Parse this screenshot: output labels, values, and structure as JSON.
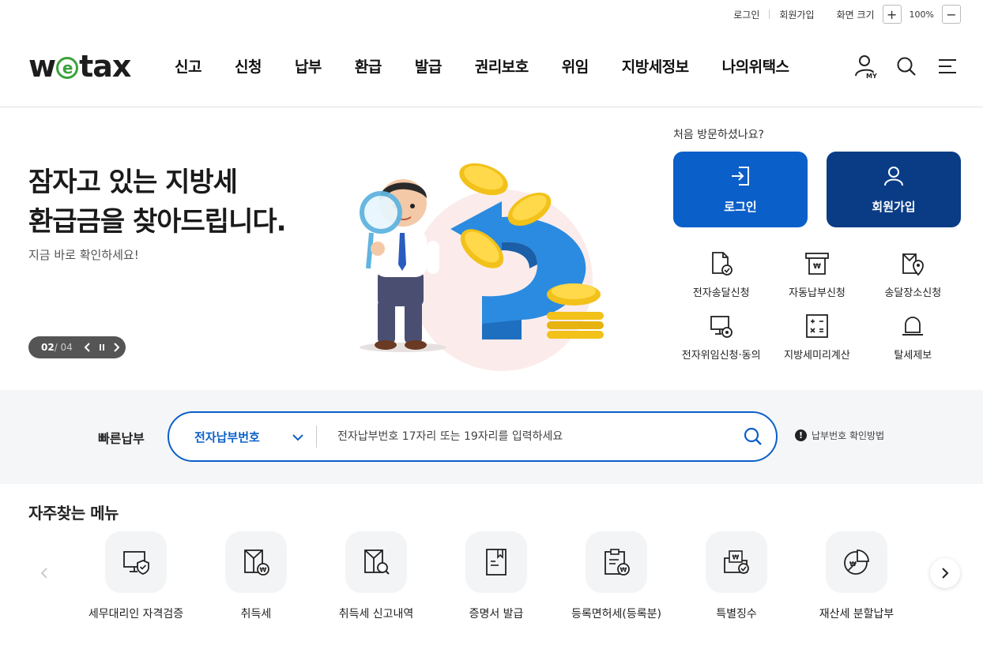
{
  "util": {
    "login": "로그인",
    "join": "회원가입",
    "zoom_label": "화면 크기",
    "zoom_in": "+",
    "zoom_value": "100%",
    "zoom_out": "−"
  },
  "header": {
    "logo": "wetax",
    "nav": [
      "신고",
      "신청",
      "납부",
      "환급",
      "발급",
      "권리보호",
      "위임",
      "지방세정보",
      "나의위택스"
    ],
    "icons": [
      "my-page-icon",
      "search-icon",
      "menu-icon"
    ],
    "my_badge": "MY"
  },
  "hero": {
    "title": "잠자고 있는 지방세\n환급금을 찾아드립니다.",
    "subtitle": "지금 바로 확인하세요!",
    "slide_current": "02",
    "slide_total": "/ 04"
  },
  "side": {
    "first_visit": "처음 방문하셨나요?",
    "login_button": "로그인",
    "join_button": "회원가입",
    "quick": [
      {
        "label": "전자송달신청",
        "icon": "e-delivery-icon"
      },
      {
        "label": "자동납부신청",
        "icon": "auto-pay-icon"
      },
      {
        "label": "송달장소신청",
        "icon": "delivery-location-icon"
      },
      {
        "label": "전자위임신청·동의",
        "icon": "e-delegation-icon"
      },
      {
        "label": "지방세미리계산",
        "icon": "calculator-icon"
      },
      {
        "label": "탈세제보",
        "icon": "alarm-bell-icon"
      }
    ]
  },
  "pay": {
    "label": "빠른납부",
    "select_value": "전자납부번호",
    "placeholder": "전자납부번호 17자리 또는 19자리를 입력하세요",
    "help": "납부번호 확인방법",
    "help_mark": "!"
  },
  "freq": {
    "title": "자주찾는 메뉴",
    "items": [
      {
        "label": "세무대리인 자격검증",
        "icon": "monitor-shield-icon"
      },
      {
        "label": "취득세",
        "icon": "acquisition-tax-icon"
      },
      {
        "label": "취득세 신고내역",
        "icon": "tax-report-search-icon"
      },
      {
        "label": "증명서 발급",
        "icon": "certificate-icon"
      },
      {
        "label": "등록면허세(등록분)",
        "icon": "clipboard-won-icon"
      },
      {
        "label": "특별징수",
        "icon": "folder-check-icon"
      },
      {
        "label": "재산세 분할납부",
        "icon": "pie-won-icon"
      }
    ]
  },
  "colors": {
    "primary": "#0b5fc8",
    "navy": "#0a3c86",
    "logo_green": "#3aa33a"
  }
}
